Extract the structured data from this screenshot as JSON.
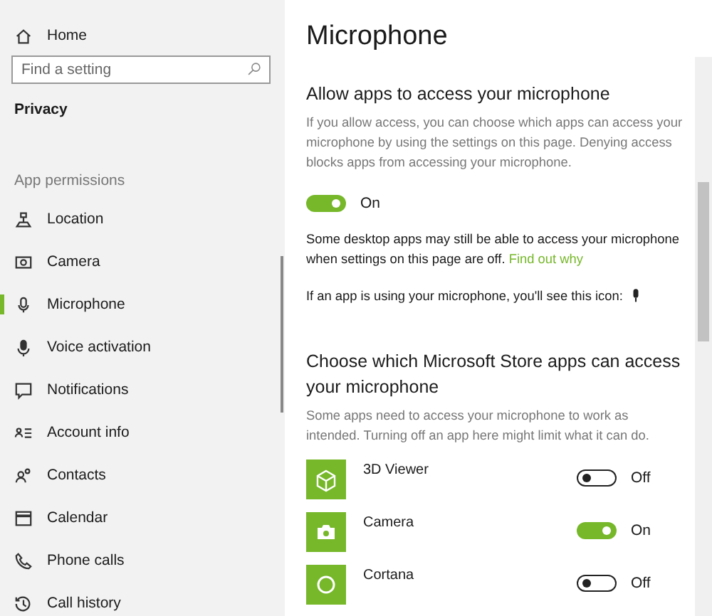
{
  "sidebar": {
    "home": {
      "label": "Home"
    },
    "search": {
      "placeholder": "Find a setting"
    },
    "section": "Privacy",
    "group_label": "App permissions",
    "items": [
      {
        "label": "Location",
        "selected": false
      },
      {
        "label": "Camera",
        "selected": false
      },
      {
        "label": "Microphone",
        "selected": true
      },
      {
        "label": "Voice activation",
        "selected": false
      },
      {
        "label": "Notifications",
        "selected": false
      },
      {
        "label": "Account info",
        "selected": false
      },
      {
        "label": "Contacts",
        "selected": false
      },
      {
        "label": "Calendar",
        "selected": false
      },
      {
        "label": "Phone calls",
        "selected": false
      },
      {
        "label": "Call history",
        "selected": false
      }
    ]
  },
  "main": {
    "title": "Microphone",
    "access": {
      "heading": "Allow apps to access your microphone",
      "description": "If you allow access, you can choose which apps can access your microphone by using the settings on this page. Denying access blocks apps from accessing your microphone.",
      "toggle": {
        "on": true,
        "label": "On"
      },
      "note": "Some desktop apps may still be able to access your microphone when settings on this page are off.",
      "link": "Find out why",
      "icon_note": "If an app is using your microphone, you'll see this icon:"
    },
    "apps_section": {
      "heading": "Choose which Microsoft Store apps can access your microphone",
      "description": "Some apps need to access your microphone to work as intended. Turning off an app here might limit what it can do.",
      "apps": [
        {
          "name": "3D Viewer",
          "on": false,
          "label": "Off"
        },
        {
          "name": "Camera",
          "on": true,
          "label": "On"
        },
        {
          "name": "Cortana",
          "on": false,
          "label": "Off"
        }
      ]
    }
  }
}
